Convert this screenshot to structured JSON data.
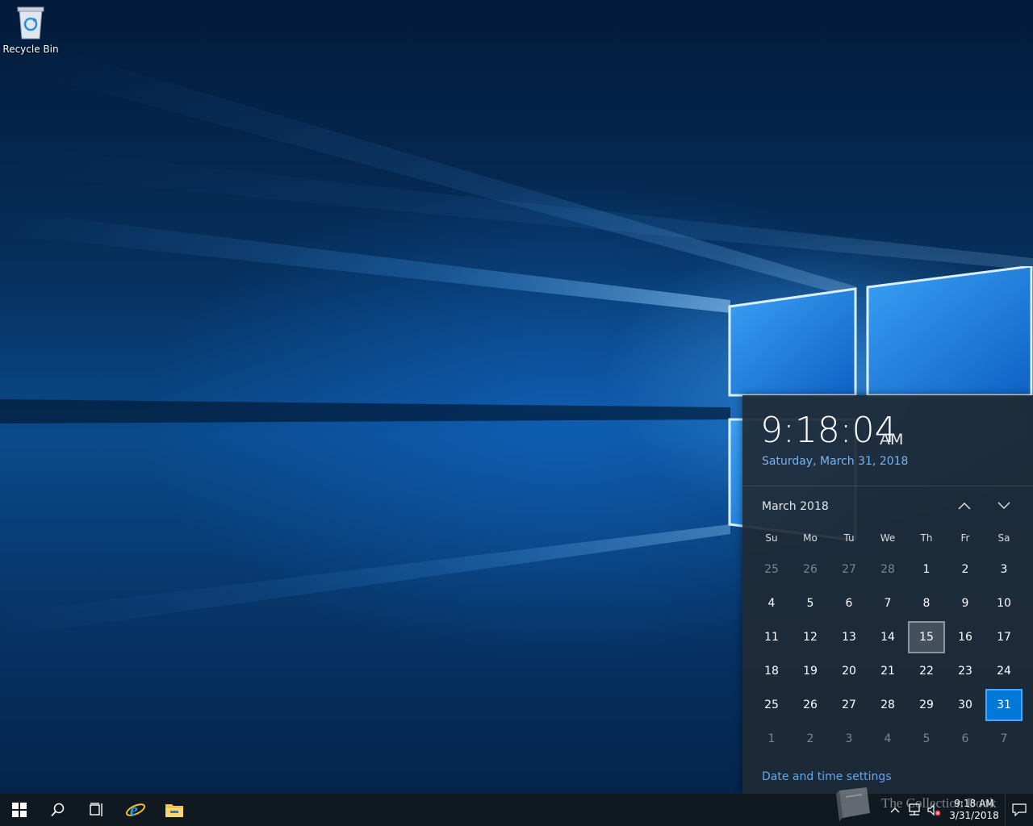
{
  "desktop": {
    "icons": [
      {
        "label": "Recycle Bin",
        "icon": "recycle-bin-icon"
      }
    ]
  },
  "clock_flyout": {
    "time": "9:18:04",
    "ampm": "AM",
    "date": "Saturday, March 31, 2018",
    "month_label": "March 2018",
    "weekdays": [
      "Su",
      "Mo",
      "Tu",
      "We",
      "Th",
      "Fr",
      "Sa"
    ],
    "days": [
      {
        "d": "25",
        "other": true
      },
      {
        "d": "26",
        "other": true
      },
      {
        "d": "27",
        "other": true
      },
      {
        "d": "28",
        "other": true
      },
      {
        "d": "1"
      },
      {
        "d": "2"
      },
      {
        "d": "3"
      },
      {
        "d": "4"
      },
      {
        "d": "5"
      },
      {
        "d": "6"
      },
      {
        "d": "7"
      },
      {
        "d": "8"
      },
      {
        "d": "9"
      },
      {
        "d": "10"
      },
      {
        "d": "11"
      },
      {
        "d": "12"
      },
      {
        "d": "13"
      },
      {
        "d": "14"
      },
      {
        "d": "15",
        "hover": true
      },
      {
        "d": "16"
      },
      {
        "d": "17"
      },
      {
        "d": "18"
      },
      {
        "d": "19"
      },
      {
        "d": "20"
      },
      {
        "d": "21"
      },
      {
        "d": "22"
      },
      {
        "d": "23"
      },
      {
        "d": "24"
      },
      {
        "d": "25"
      },
      {
        "d": "26"
      },
      {
        "d": "27"
      },
      {
        "d": "28"
      },
      {
        "d": "29"
      },
      {
        "d": "30"
      },
      {
        "d": "31",
        "today": true
      },
      {
        "d": "1",
        "other": true
      },
      {
        "d": "2",
        "other": true
      },
      {
        "d": "3",
        "other": true
      },
      {
        "d": "4",
        "other": true
      },
      {
        "d": "5",
        "other": true
      },
      {
        "d": "6",
        "other": true
      },
      {
        "d": "7",
        "other": true
      }
    ],
    "settings_link": "Date and time settings",
    "accent_color": "#0078d7",
    "link_color": "#60a8ee"
  },
  "taskbar": {
    "buttons": [
      {
        "name": "start-button",
        "icon": "windows-logo-icon"
      },
      {
        "name": "search-button",
        "icon": "search-icon"
      },
      {
        "name": "task-view-button",
        "icon": "task-view-icon"
      },
      {
        "name": "internet-explorer-button",
        "icon": "internet-explorer-icon"
      },
      {
        "name": "file-explorer-button",
        "icon": "file-explorer-icon"
      }
    ],
    "tray": {
      "icons": [
        "chevron-up-icon",
        "network-icon",
        "volume-muted-icon"
      ],
      "time": "9:18 AM",
      "date": "3/31/2018"
    }
  },
  "watermark": {
    "text": "The Collection Book"
  }
}
